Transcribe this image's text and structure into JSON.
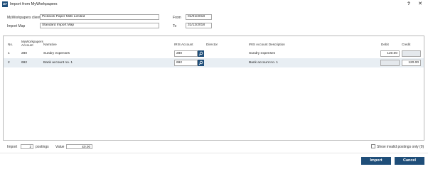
{
  "window": {
    "icon_text": "MP",
    "title": "Import from MyWorkpapers",
    "help_label": "?",
    "close_label": "✕"
  },
  "header": {
    "client_label": "MyWorkpapers client",
    "client_value": "Pickwick Paper Mills Limited",
    "map_label": "Import Map",
    "map_value": "Standard Import Map",
    "from_label": "From",
    "from_value": "01/01/2018",
    "to_label": "To",
    "to_value": "31/12/2018"
  },
  "columns": {
    "no": "No.",
    "account": "MyWorkpapers Account",
    "narrative": "Narrative",
    "iris_account": "IRIS Account",
    "director": "Director",
    "iris_desc": "IRIS Account Description",
    "debit": "Debit",
    "credit": "Credit"
  },
  "rows": [
    {
      "no": "1",
      "account": "280",
      "narrative": "Sundry expenses",
      "iris_account": "280",
      "director": "",
      "iris_desc": "Sundry expenses",
      "debit": "120.00",
      "credit": ""
    },
    {
      "no": "2",
      "account": "692",
      "narrative": "Bank account no. 1",
      "iris_account": "692",
      "director": "",
      "iris_desc": "Bank account no. 1",
      "debit": "",
      "credit": "120.00"
    }
  ],
  "footer": {
    "import_label": "Import",
    "import_count": "2",
    "postings_label": "postings",
    "value_label": "Value",
    "value": "£0.00",
    "invalid_label": "Show invalid postings only (0)"
  },
  "actions": {
    "import_label": "Import",
    "cancel_label": "Cancel"
  },
  "colors": {
    "accent": "#1f4e79",
    "row_alt": "#e8eef3"
  },
  "icons": {
    "lookup": "search-icon",
    "app": "app-icon"
  }
}
